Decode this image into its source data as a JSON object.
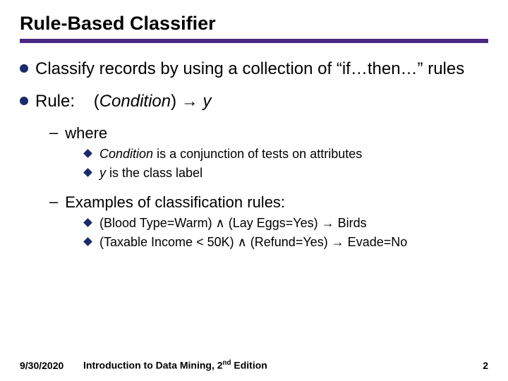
{
  "title": "Rule-Based Classifier",
  "points": {
    "p1": "Classify records by using a collection of “if…then…” rules",
    "p2_label": "Rule:",
    "p2_cond": "Condition",
    "p2_arrow": "→",
    "p2_y": "y",
    "where": "where",
    "w1_a": "Condition",
    "w1_b": " is a conjunction of tests on attributes",
    "w2_a": "y",
    "w2_b": " is the class label",
    "ex_label": "Examples of classification rules:",
    "ex1": "(Blood Type=Warm) ∧ (Lay Eggs=Yes) → Birds",
    "ex2": "(Taxable Income < 50K) ∧ (Refund=Yes) → Evade=No"
  },
  "footer": {
    "date": "9/30/2020",
    "book_a": "Introduction to Data Mining, 2",
    "book_sup": "nd",
    "book_b": " Edition",
    "page": "2"
  }
}
